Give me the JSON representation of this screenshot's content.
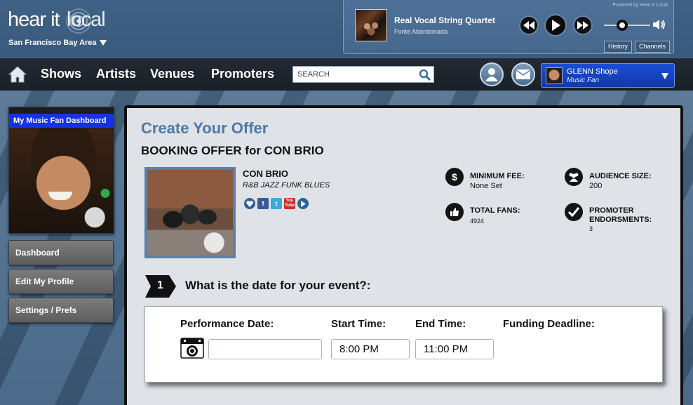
{
  "header": {
    "logo_hear": "hear it",
    "logo_local": "local",
    "region": "San Francisco Bay Area"
  },
  "player": {
    "powered_by": "Powered by Hear It Local",
    "track_title": "Real Vocal String Quartet",
    "track_subtitle": "Fonte Abandonada",
    "history_label": "History",
    "channels_label": "Channels",
    "volume_level": 0.35
  },
  "nav": {
    "shows": "Shows",
    "artists": "Artists",
    "venues": "Venues",
    "promoters": "Promoters",
    "search_placeholder": "SEARCH"
  },
  "user": {
    "name": "GLENN Shope",
    "role": "Music Fan"
  },
  "sidebar": {
    "dashboard_title": "My Music Fan Dashboard",
    "items": [
      {
        "label": "Dashboard"
      },
      {
        "label": "Edit My Profile"
      },
      {
        "label": "Settings / Prefs"
      }
    ]
  },
  "offer": {
    "title": "Create Your Offer",
    "booking_title": "BOOKING OFFER for CON BRIO",
    "band_name": "CON BRIO",
    "genres": "R&B JAZZ FUNK BLUES",
    "stats": {
      "min_fee_label": "MINIMUM FEE:",
      "min_fee_value": "None Set",
      "audience_label": "AUDIENCE SIZE:",
      "audience_value": "200",
      "fans_label": "TOTAL FANS:",
      "fans_value": "4924",
      "endorse_label": "PROMOTER ENDORSMENTS:",
      "endorse_value": "3"
    },
    "step_number": "1",
    "step_question": "What is the date for your event?:",
    "fields": {
      "performance_date_label": "Performance Date:",
      "performance_date_value": "",
      "start_time_label": "Start Time:",
      "start_time_value": "8:00 PM",
      "end_time_label": "End Time:",
      "end_time_value": "11:00 PM",
      "funding_deadline_label": "Funding Deadline:"
    }
  },
  "colors": {
    "header_bg": "#3f6185",
    "nav_bg": "#1d232b",
    "accent_blue": "#1533e6",
    "title_blue": "#4d79a6"
  }
}
